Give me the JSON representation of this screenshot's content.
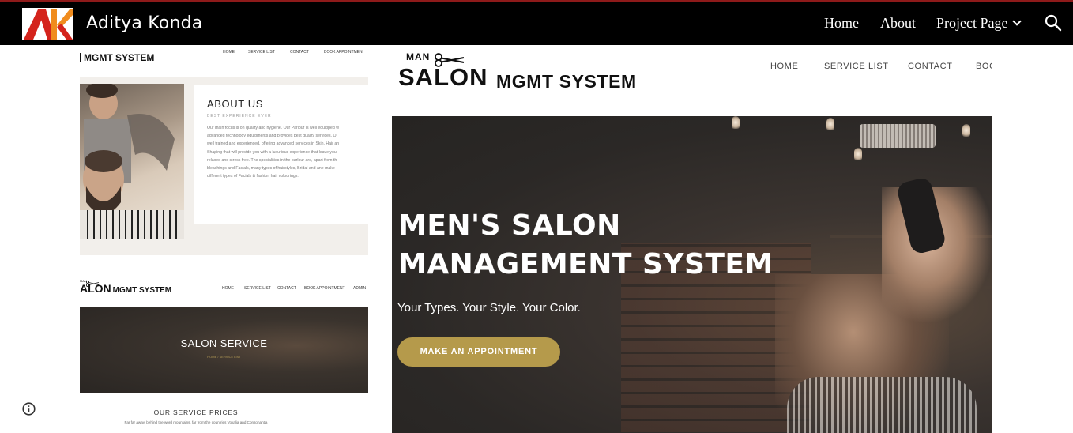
{
  "header": {
    "site_title": "Aditya Konda",
    "nav": [
      {
        "label": "Home"
      },
      {
        "label": "About"
      },
      {
        "label": "Project Page"
      }
    ],
    "colors": {
      "background": "#000000",
      "accent_line": "#8e1a1a",
      "logo_red": "#d4231c",
      "logo_orange": "#f08c1e"
    }
  },
  "screens": {
    "about_page": {
      "brand": "MGMT SYSTEM",
      "nav": [
        "HOME",
        "SERVICE LIST",
        "CONTACT",
        "BOOK APPOINTMEN"
      ],
      "about_title": "ABOUT US",
      "about_subtitle": "BEST EXPERIENCE EVER",
      "about_lines": [
        "Our main focus is on quality and hygiene. Our Parlour is well equipped w",
        "advanced technology equipments and provides best quality services. O",
        "well trained and experienced, offering advanced services in Skin, Hair an",
        "Shaping that will provide you with a luxurious experience that leave you",
        "relaxed and stress free. The specialities in the parlour are, apart from th",
        "bleachings and Facials, many types of hairstyles, Bridal and ane make-",
        "different types of Facials & fashion hair colourings."
      ]
    },
    "service_page": {
      "brand_tiny": "MAN",
      "brand_big": "ALON",
      "brand_small": "MGMT SYSTEM",
      "nav": [
        "HOME",
        "SERVICE LIST",
        "CONTACT",
        "BOOK APPOINTMENT",
        "ADMIN"
      ],
      "hero_title": "SALON SERVICE",
      "breadcrumb": "HOME / SERVICE LIST",
      "prices_title": "OUR SERVICE PRICES",
      "prices_tagline": "Far far away, behind the word mountains, far from the countries Vokalia and Consonantia"
    },
    "home_preview": {
      "brand_man": "MAN",
      "brand_salon": "SALON",
      "brand_mgmt": "MGMT SYSTEM",
      "nav": [
        "HOME",
        "SERVICE LIST",
        "CONTACT",
        "BOO"
      ],
      "hero_title_line1": "MEN'S SALON",
      "hero_title_line2": "MANAGEMENT SYSTEM",
      "hero_tagline": "Your Types. Your Style. Your Color.",
      "cta_label": "MAKE AN APPOINTMENT",
      "cta_color": "#b59a4b"
    }
  },
  "icons": {
    "search": "search-icon",
    "chevron": "chevron-down-icon",
    "info": "info-icon",
    "scissors": "scissors-icon"
  }
}
